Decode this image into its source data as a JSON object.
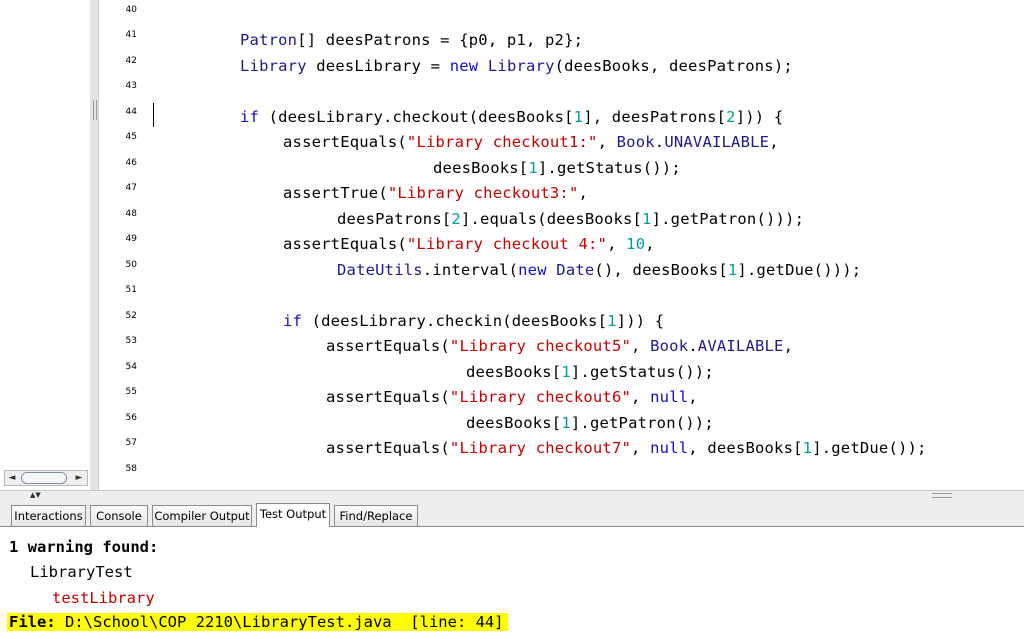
{
  "editor": {
    "line_numbers": [
      "40",
      "41",
      "42",
      "43",
      "44",
      "45",
      "46",
      "47",
      "48",
      "49",
      "50",
      "51",
      "52",
      "53",
      "54",
      "55",
      "56",
      "57",
      "58"
    ],
    "code": {
      "l41": {
        "t1": "Patron",
        "t2": "[] deesPatrons = {p0, p1, p2};"
      },
      "l42": {
        "t1": "Library",
        "t2": " deesLibrary = ",
        "t3": "new",
        "t4": " ",
        "t5": "Library",
        "t6": "(deesBooks, deesPatrons);"
      },
      "l44": {
        "t1": "if",
        "t2": " (deesLibrary.checkout(deesBooks[",
        "t3": "1",
        "t4": "], deesPatrons[",
        "t5": "2",
        "t6": "])) {"
      },
      "l45": {
        "t1": "assertEquals(",
        "t2": "\"Library checkout1:\"",
        "t3": ", ",
        "t4": "Book",
        "t5": ".",
        "t6": "UNAVAILABLE",
        "t7": ","
      },
      "l46": {
        "t1": "deesBooks[",
        "t2": "1",
        "t3": "].getStatus());"
      },
      "l47": {
        "t1": "assertTrue(",
        "t2": "\"Library checkout3:\"",
        "t3": ","
      },
      "l48": {
        "t1": "deesPatrons[",
        "t2": "2",
        "t3": "].equals(deesBooks[",
        "t4": "1",
        "t5": "].getPatron()));"
      },
      "l49": {
        "t1": "assertEquals(",
        "t2": "\"Library checkout 4:\"",
        "t3": ", ",
        "t4": "10",
        "t5": ","
      },
      "l50": {
        "t1": "DateUtils",
        "t2": ".interval(",
        "t3": "new",
        "t4": " ",
        "t5": "Date",
        "t6": "(), deesBooks[",
        "t7": "1",
        "t8": "].getDue()));"
      },
      "l52": {
        "t1": "if",
        "t2": " (deesLibrary.checkin(deesBooks[",
        "t3": "1",
        "t4": "])) {"
      },
      "l53": {
        "t1": "assertEquals(",
        "t2": "\"Library checkout5\"",
        "t3": ", ",
        "t4": "Book",
        "t5": ".",
        "t6": "AVAILABLE",
        "t7": ","
      },
      "l54": {
        "t1": "deesBooks[",
        "t2": "1",
        "t3": "].getStatus());"
      },
      "l55": {
        "t1": "assertEquals(",
        "t2": "\"Library checkout6\"",
        "t3": ", ",
        "t4": "null",
        "t5": ","
      },
      "l56": {
        "t1": "deesBooks[",
        "t2": "1",
        "t3": "].getPatron());"
      },
      "l57": {
        "t1": "assertEquals(",
        "t2": "\"Library checkout7\"",
        "t3": ", ",
        "t4": "null",
        "t5": ", deesBooks[",
        "t6": "1",
        "t7": "].getDue());"
      }
    }
  },
  "scroll": {
    "left_arrow": "◄",
    "right_arrow": "►",
    "split_arrows": "▲▼"
  },
  "tabs": [
    "Interactions",
    "Console",
    "Compiler Output",
    "Test Output",
    "Find/Replace"
  ],
  "active_tab": "Test Output",
  "output": {
    "warning": "1 warning found:",
    "class_name": "LibraryTest",
    "method_name": "testLibrary",
    "file_line": "File: D:\\School\\COP 2210\\LibraryTest.java  [line: 44]"
  },
  "colors": {
    "keyword": "#1010c8",
    "string": "#c80000",
    "number": "#00a0a0",
    "highlight": "#ffff00"
  }
}
